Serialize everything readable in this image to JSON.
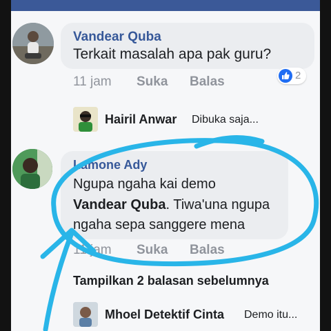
{
  "comments": [
    {
      "author": "Vandear Quba",
      "text": "Terkait masalah apa pak guru?",
      "time": "11 jam",
      "like_label": "Suka",
      "reply_label": "Balas",
      "reaction_count": "2",
      "reaction_icon": "like-icon"
    },
    {
      "author": "Lamone Ady",
      "text_line1": "Ngupa ngaha kai demo",
      "mention": "Vandear Quba",
      "text_line2_rest": ". Tiwa'una ngupa",
      "text_line3": "ngaha sepa sanggere mena",
      "time": "11 jam",
      "like_label": "Suka",
      "reply_label": "Balas"
    }
  ],
  "replies": [
    {
      "author": "Hairil Anwar",
      "text": "Dibuka saja..."
    },
    {
      "author": "Mhoel Detektif Cinta",
      "text": "Demo itu..."
    }
  ],
  "show_previous_replies": "Tampilkan 2 balasan sebelumnya",
  "colors": {
    "name_link": "#365899",
    "bubble": "#ebedf0",
    "meta": "#90949c",
    "annotation": "#29b5e8",
    "like_blue": "#1f6df3"
  }
}
